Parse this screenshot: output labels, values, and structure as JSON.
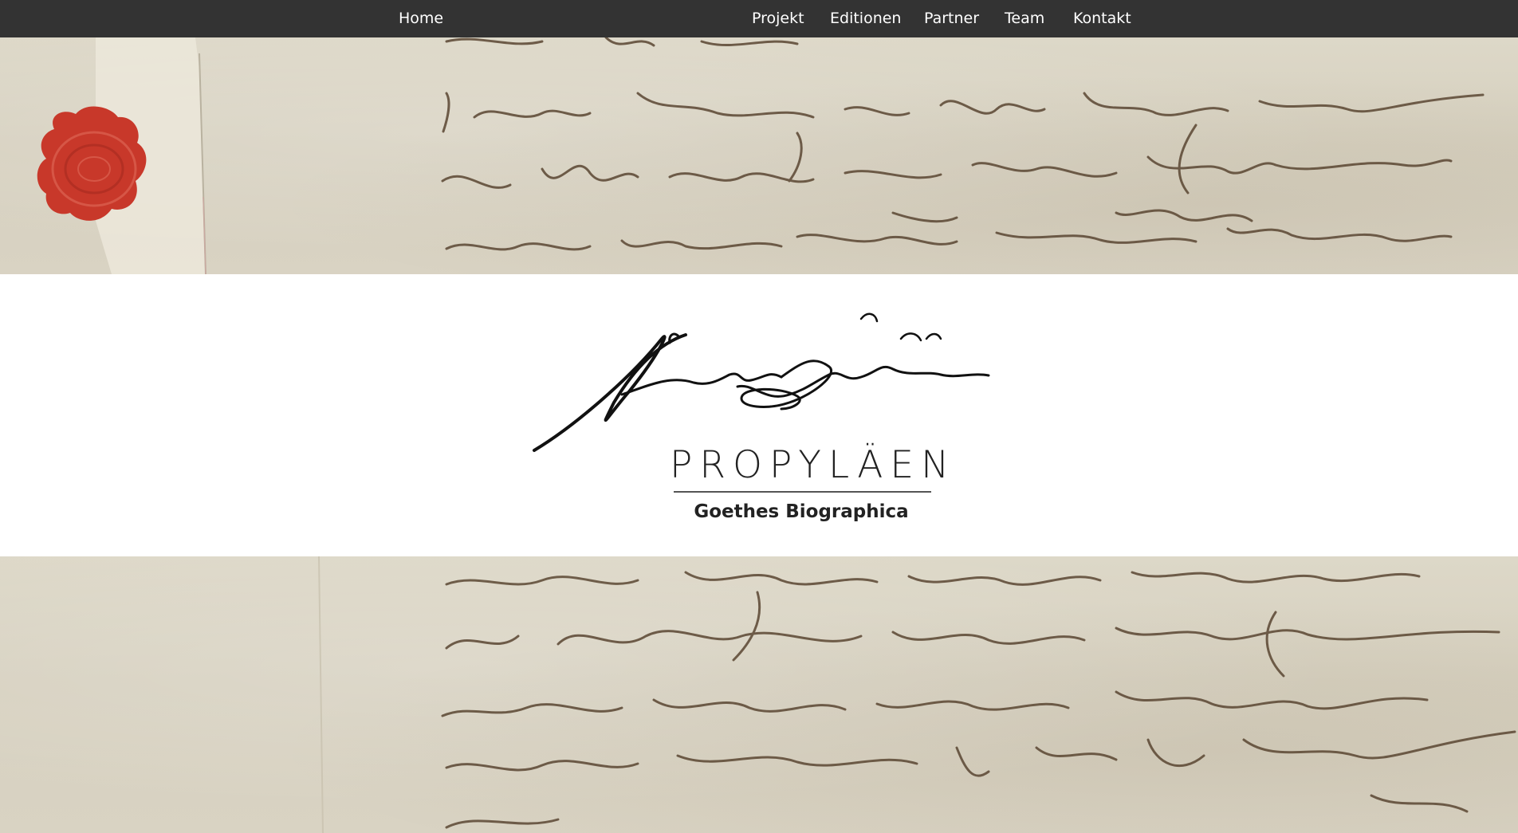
{
  "nav": {
    "home": "Home",
    "items": [
      "Projekt",
      "Editionen",
      "Partner",
      "Team",
      "Kontakt"
    ]
  },
  "brand": {
    "title": "PROPYLÄEN",
    "subtitle": "Goethes Biographica",
    "signature_text": "Propyläen"
  },
  "colors": {
    "navbar": "#333333",
    "nav_text": "#ffffff",
    "paper": "#d8d2c2",
    "ink": "#5a4632",
    "seal": "#c8382a",
    "brand_text": "#222222"
  },
  "icons": {
    "seal": "wax-seal"
  }
}
